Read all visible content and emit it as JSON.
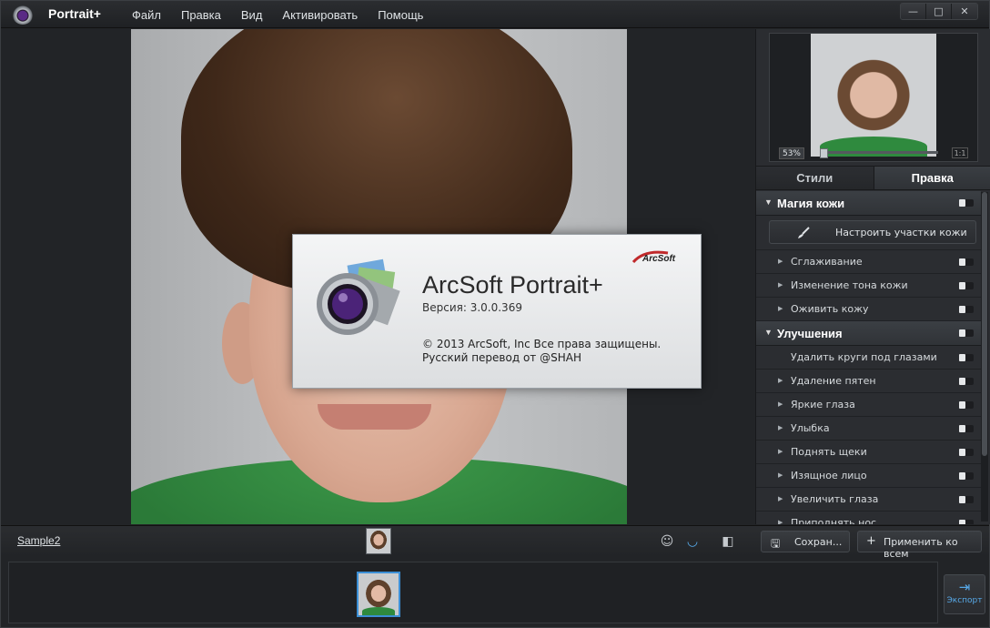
{
  "app": {
    "name": "Portrait+"
  },
  "menu": [
    "Файл",
    "Правка",
    "Вид",
    "Активировать",
    "Помощь"
  ],
  "window_controls": [
    "—",
    "□",
    "✕"
  ],
  "preview": {
    "zoom": "53%",
    "one_to_one": "1:1"
  },
  "tabs": [
    {
      "label": "Стили",
      "active": false
    },
    {
      "label": "Правка",
      "active": true
    }
  ],
  "sections": {
    "skin": {
      "title": "Магия кожи",
      "button": "Настроить участки кожи",
      "items": [
        "Сглаживание",
        "Изменение тона кожи",
        "Оживить кожу"
      ]
    },
    "enhance": {
      "title": "Улучшения",
      "first": "Удалить круги под глазами",
      "items": [
        "Удаление пятен",
        "Яркие глаза",
        "Улыбка",
        "Поднять щеки",
        "Изящное лицо",
        "Увеличить глаза",
        "Приподнять нос"
      ]
    }
  },
  "about": {
    "title": "ArcSoft Portrait+",
    "version": "Версия: 3.0.0.369",
    "copyright": "© 2013 ArcSoft, Inc Все права защищены.",
    "translation": "Русский перевод от @SHAH",
    "brand": "ArcSoft"
  },
  "bottom": {
    "sample": "Sample2",
    "save": "Сохран...",
    "apply_all": "Применить ко всем",
    "export": "Экспорт"
  },
  "colors": {
    "accent": "#3b8fd6",
    "export": "#57a9e8",
    "shirt": "#2f8a3e"
  }
}
